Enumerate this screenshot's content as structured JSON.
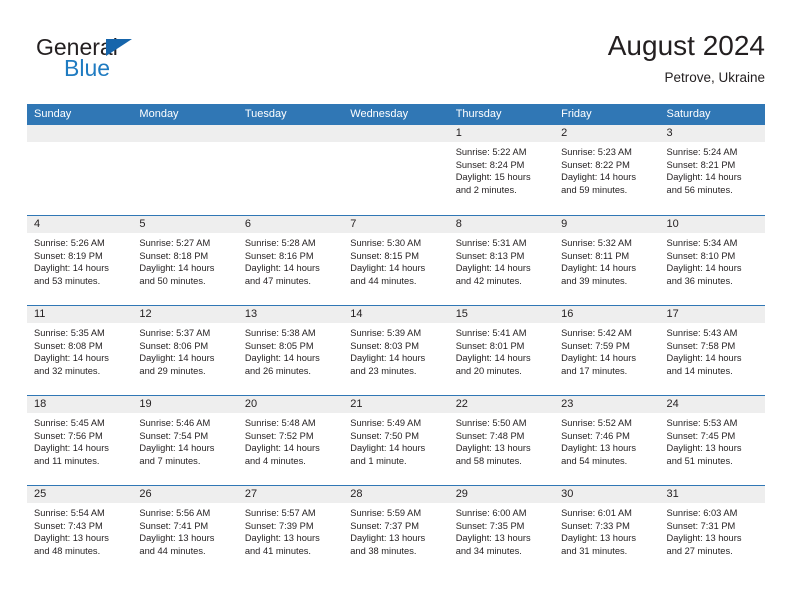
{
  "brand": {
    "name_part1": "General",
    "name_part2": "Blue",
    "triangle_color": "#1665AB",
    "blue_color": "#1F7BC1"
  },
  "header": {
    "title": "August 2024",
    "subtitle": "Petrove, Ukraine"
  },
  "theme": {
    "header_blue": "#3077B5",
    "daynum_band": "#EEEEEE",
    "text": "#231F20"
  },
  "weekday_headers": [
    "Sunday",
    "Monday",
    "Tuesday",
    "Wednesday",
    "Thursday",
    "Friday",
    "Saturday"
  ],
  "weeks": [
    [
      {
        "day": "",
        "lines": []
      },
      {
        "day": "",
        "lines": []
      },
      {
        "day": "",
        "lines": []
      },
      {
        "day": "",
        "lines": []
      },
      {
        "day": "1",
        "lines": [
          "Sunrise: 5:22 AM",
          "Sunset: 8:24 PM",
          "Daylight: 15 hours",
          "and 2 minutes."
        ]
      },
      {
        "day": "2",
        "lines": [
          "Sunrise: 5:23 AM",
          "Sunset: 8:22 PM",
          "Daylight: 14 hours",
          "and 59 minutes."
        ]
      },
      {
        "day": "3",
        "lines": [
          "Sunrise: 5:24 AM",
          "Sunset: 8:21 PM",
          "Daylight: 14 hours",
          "and 56 minutes."
        ]
      }
    ],
    [
      {
        "day": "4",
        "lines": [
          "Sunrise: 5:26 AM",
          "Sunset: 8:19 PM",
          "Daylight: 14 hours",
          "and 53 minutes."
        ]
      },
      {
        "day": "5",
        "lines": [
          "Sunrise: 5:27 AM",
          "Sunset: 8:18 PM",
          "Daylight: 14 hours",
          "and 50 minutes."
        ]
      },
      {
        "day": "6",
        "lines": [
          "Sunrise: 5:28 AM",
          "Sunset: 8:16 PM",
          "Daylight: 14 hours",
          "and 47 minutes."
        ]
      },
      {
        "day": "7",
        "lines": [
          "Sunrise: 5:30 AM",
          "Sunset: 8:15 PM",
          "Daylight: 14 hours",
          "and 44 minutes."
        ]
      },
      {
        "day": "8",
        "lines": [
          "Sunrise: 5:31 AM",
          "Sunset: 8:13 PM",
          "Daylight: 14 hours",
          "and 42 minutes."
        ]
      },
      {
        "day": "9",
        "lines": [
          "Sunrise: 5:32 AM",
          "Sunset: 8:11 PM",
          "Daylight: 14 hours",
          "and 39 minutes."
        ]
      },
      {
        "day": "10",
        "lines": [
          "Sunrise: 5:34 AM",
          "Sunset: 8:10 PM",
          "Daylight: 14 hours",
          "and 36 minutes."
        ]
      }
    ],
    [
      {
        "day": "11",
        "lines": [
          "Sunrise: 5:35 AM",
          "Sunset: 8:08 PM",
          "Daylight: 14 hours",
          "and 32 minutes."
        ]
      },
      {
        "day": "12",
        "lines": [
          "Sunrise: 5:37 AM",
          "Sunset: 8:06 PM",
          "Daylight: 14 hours",
          "and 29 minutes."
        ]
      },
      {
        "day": "13",
        "lines": [
          "Sunrise: 5:38 AM",
          "Sunset: 8:05 PM",
          "Daylight: 14 hours",
          "and 26 minutes."
        ]
      },
      {
        "day": "14",
        "lines": [
          "Sunrise: 5:39 AM",
          "Sunset: 8:03 PM",
          "Daylight: 14 hours",
          "and 23 minutes."
        ]
      },
      {
        "day": "15",
        "lines": [
          "Sunrise: 5:41 AM",
          "Sunset: 8:01 PM",
          "Daylight: 14 hours",
          "and 20 minutes."
        ]
      },
      {
        "day": "16",
        "lines": [
          "Sunrise: 5:42 AM",
          "Sunset: 7:59 PM",
          "Daylight: 14 hours",
          "and 17 minutes."
        ]
      },
      {
        "day": "17",
        "lines": [
          "Sunrise: 5:43 AM",
          "Sunset: 7:58 PM",
          "Daylight: 14 hours",
          "and 14 minutes."
        ]
      }
    ],
    [
      {
        "day": "18",
        "lines": [
          "Sunrise: 5:45 AM",
          "Sunset: 7:56 PM",
          "Daylight: 14 hours",
          "and 11 minutes."
        ]
      },
      {
        "day": "19",
        "lines": [
          "Sunrise: 5:46 AM",
          "Sunset: 7:54 PM",
          "Daylight: 14 hours",
          "and 7 minutes."
        ]
      },
      {
        "day": "20",
        "lines": [
          "Sunrise: 5:48 AM",
          "Sunset: 7:52 PM",
          "Daylight: 14 hours",
          "and 4 minutes."
        ]
      },
      {
        "day": "21",
        "lines": [
          "Sunrise: 5:49 AM",
          "Sunset: 7:50 PM",
          "Daylight: 14 hours",
          "and 1 minute."
        ]
      },
      {
        "day": "22",
        "lines": [
          "Sunrise: 5:50 AM",
          "Sunset: 7:48 PM",
          "Daylight: 13 hours",
          "and 58 minutes."
        ]
      },
      {
        "day": "23",
        "lines": [
          "Sunrise: 5:52 AM",
          "Sunset: 7:46 PM",
          "Daylight: 13 hours",
          "and 54 minutes."
        ]
      },
      {
        "day": "24",
        "lines": [
          "Sunrise: 5:53 AM",
          "Sunset: 7:45 PM",
          "Daylight: 13 hours",
          "and 51 minutes."
        ]
      }
    ],
    [
      {
        "day": "25",
        "lines": [
          "Sunrise: 5:54 AM",
          "Sunset: 7:43 PM",
          "Daylight: 13 hours",
          "and 48 minutes."
        ]
      },
      {
        "day": "26",
        "lines": [
          "Sunrise: 5:56 AM",
          "Sunset: 7:41 PM",
          "Daylight: 13 hours",
          "and 44 minutes."
        ]
      },
      {
        "day": "27",
        "lines": [
          "Sunrise: 5:57 AM",
          "Sunset: 7:39 PM",
          "Daylight: 13 hours",
          "and 41 minutes."
        ]
      },
      {
        "day": "28",
        "lines": [
          "Sunrise: 5:59 AM",
          "Sunset: 7:37 PM",
          "Daylight: 13 hours",
          "and 38 minutes."
        ]
      },
      {
        "day": "29",
        "lines": [
          "Sunrise: 6:00 AM",
          "Sunset: 7:35 PM",
          "Daylight: 13 hours",
          "and 34 minutes."
        ]
      },
      {
        "day": "30",
        "lines": [
          "Sunrise: 6:01 AM",
          "Sunset: 7:33 PM",
          "Daylight: 13 hours",
          "and 31 minutes."
        ]
      },
      {
        "day": "31",
        "lines": [
          "Sunrise: 6:03 AM",
          "Sunset: 7:31 PM",
          "Daylight: 13 hours",
          "and 27 minutes."
        ]
      }
    ]
  ]
}
